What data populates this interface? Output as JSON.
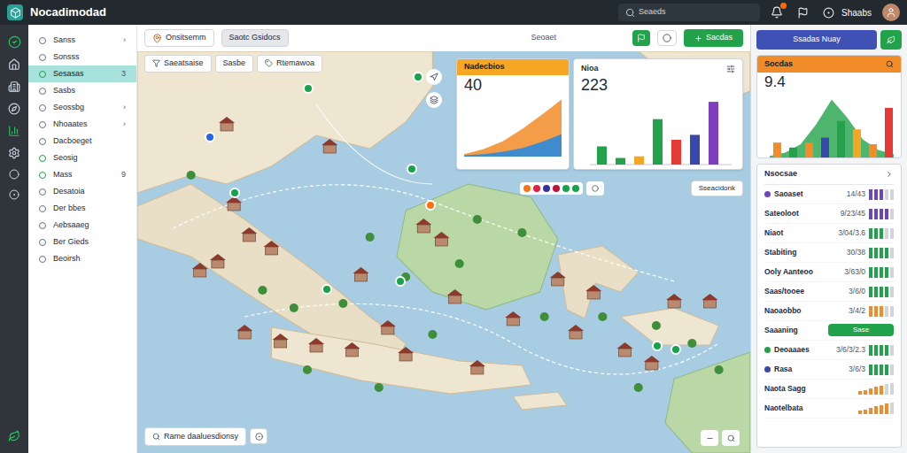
{
  "app": {
    "title": "Nocadimodad"
  },
  "search": {
    "placeholder": "Seaeds"
  },
  "user": {
    "name": "Shaabs"
  },
  "sidebar": {
    "items": [
      {
        "label": "Sanss",
        "selected": false,
        "trailing": "›",
        "color": "#6b7280"
      },
      {
        "label": "Sonsss",
        "selected": false,
        "trailing": "",
        "color": "#6b7280"
      },
      {
        "label": "Sesasas",
        "selected": true,
        "trailing": "3",
        "color": "#16a34a"
      },
      {
        "label": "Sasbs",
        "selected": false,
        "trailing": "",
        "color": "#6b7280"
      },
      {
        "label": "Seossbg",
        "selected": false,
        "trailing": "›",
        "color": "#6b7280"
      },
      {
        "label": "Nhoaates",
        "selected": false,
        "trailing": "›",
        "color": "#6b7280"
      },
      {
        "label": "Dacboeget",
        "selected": false,
        "trailing": "",
        "color": "#6b7280"
      },
      {
        "label": "Seosig",
        "selected": false,
        "trailing": "",
        "color": "#16a34a"
      },
      {
        "label": "Mass",
        "selected": false,
        "trailing": "9",
        "color": "#16a34a"
      },
      {
        "label": "Desatoia",
        "selected": false,
        "trailing": "",
        "color": "#6b7280"
      },
      {
        "label": "Der bbes",
        "selected": false,
        "trailing": "",
        "color": "#6b7280"
      },
      {
        "label": "Aebsaaeg",
        "selected": false,
        "trailing": "",
        "color": "#6b7280"
      },
      {
        "label": "Ber Gieds",
        "selected": false,
        "trailing": "",
        "color": "#6b7280"
      },
      {
        "label": "Beoirsh",
        "selected": false,
        "trailing": "",
        "color": "#6b7280"
      }
    ]
  },
  "toolbar": {
    "primary": "Onsitsemm",
    "secondary": "Saotc Gsidocs",
    "label": "Seoaet",
    "action": "Sacdas"
  },
  "filters": [
    "Saeatsaise",
    "Sasbe",
    "Rtemawoa"
  ],
  "map": {
    "pins": [
      {
        "color": "#2563eb"
      },
      {
        "color": "#16a34a"
      },
      {
        "color": "#16a34a"
      },
      {
        "color": "#16a34a"
      },
      {
        "color": "#16a34a"
      },
      {
        "color": "#f97316"
      },
      {
        "color": "#16a34a"
      },
      {
        "color": "#16a34a"
      },
      {
        "color": "#16a34a"
      },
      {
        "color": "#16a34a"
      }
    ],
    "legend": [
      {
        "color": "#f97316"
      },
      {
        "color": "#e11d48"
      },
      {
        "color": "#3730a3"
      },
      {
        "color": "#be123c"
      },
      {
        "color": "#16a34a"
      },
      {
        "color": "#16a34a"
      }
    ],
    "layers_button": "Sseacidonk",
    "search": "Rame daaluesdionsy"
  },
  "cards": [
    {
      "title": "Nadecbios",
      "value": "40",
      "series": [
        {
          "color": "#f28c28",
          "values": [
            4,
            12,
            25,
            45,
            68,
            92
          ]
        },
        {
          "color": "#1e88e5",
          "values": [
            2,
            4,
            8,
            14,
            24,
            36
          ]
        }
      ]
    },
    {
      "title": "Nioa",
      "value": "223",
      "bars": [
        {
          "value": 22,
          "color": "#22a24a"
        },
        {
          "value": 8,
          "color": "#22a24a"
        },
        {
          "value": 10,
          "color": "#f5a623"
        },
        {
          "value": 55,
          "color": "#22a24a"
        },
        {
          "value": 30,
          "color": "#e53935"
        },
        {
          "value": 36,
          "color": "#3949ab"
        },
        {
          "value": 76,
          "color": "#7e3fbf"
        }
      ]
    }
  ],
  "right_panel": {
    "button": "Ssadas Nuay",
    "chart": {
      "title": "Socdas",
      "value": "9.4",
      "curve": [
        2,
        6,
        16,
        40,
        70,
        48,
        22,
        9,
        4
      ],
      "bars": [
        {
          "value": 18,
          "color": "#f28c28"
        },
        {
          "value": 12,
          "color": "#22a24a"
        },
        {
          "value": 18,
          "color": "#f28c28"
        },
        {
          "value": 24,
          "color": "#3949ab"
        },
        {
          "value": 44,
          "color": "#22a24a"
        },
        {
          "value": 34,
          "color": "#f5a623"
        },
        {
          "value": 16,
          "color": "#f28c28"
        },
        {
          "value": 60,
          "color": "#e53935"
        }
      ]
    },
    "list": {
      "title": "Nsocsae",
      "rows": [
        {
          "name": "Saoaset",
          "value": "14/43",
          "kind": "meter",
          "level": 0.6,
          "color": "#6b46c1",
          "marker": "#6b46c1"
        },
        {
          "name": "Sateoloot",
          "value": "9/23/45",
          "kind": "meter",
          "level": 0.8,
          "color": "#6b46c1",
          "marker": ""
        },
        {
          "name": "Niaot",
          "value": "3/04/3.6",
          "kind": "meter",
          "level": 0.6,
          "color": "#22a24a",
          "marker": ""
        },
        {
          "name": "Stabiting",
          "value": "30/38",
          "kind": "meter",
          "level": 0.8,
          "color": "#22a24a",
          "marker": ""
        },
        {
          "name": "Ooly Aanteoo",
          "value": "3/63/0",
          "kind": "meter",
          "level": 0.8,
          "color": "#22a24a",
          "marker": ""
        },
        {
          "name": "Saas/tooee",
          "value": "3/6/0",
          "kind": "meter",
          "level": 0.8,
          "color": "#22a24a",
          "marker": ""
        },
        {
          "name": "Naoaobbo",
          "value": "3/4/2",
          "kind": "meter",
          "level": 0.6,
          "color": "#f28c28",
          "marker": ""
        },
        {
          "name": "Saaaning",
          "value": "Sase",
          "kind": "bar",
          "level": 1,
          "color": "#22a24a",
          "marker": ""
        },
        {
          "name": "Deoaaaes",
          "value": "3/6/3/2.3",
          "kind": "meter",
          "level": 0.8,
          "color": "#22a24a",
          "marker": "#22a24a"
        },
        {
          "name": "Rasa",
          "value": "3/6/3",
          "kind": "meter",
          "level": 0.8,
          "color": "#22a24a",
          "marker": "#3949ab"
        },
        {
          "name": "Naota Sagg",
          "value": "",
          "kind": "trend",
          "level": 0.7,
          "color": "#f28c28",
          "marker": ""
        },
        {
          "name": "Naotelbata",
          "value": "",
          "kind": "trend",
          "level": 0.85,
          "color": "#f28c28",
          "marker": ""
        }
      ]
    }
  }
}
